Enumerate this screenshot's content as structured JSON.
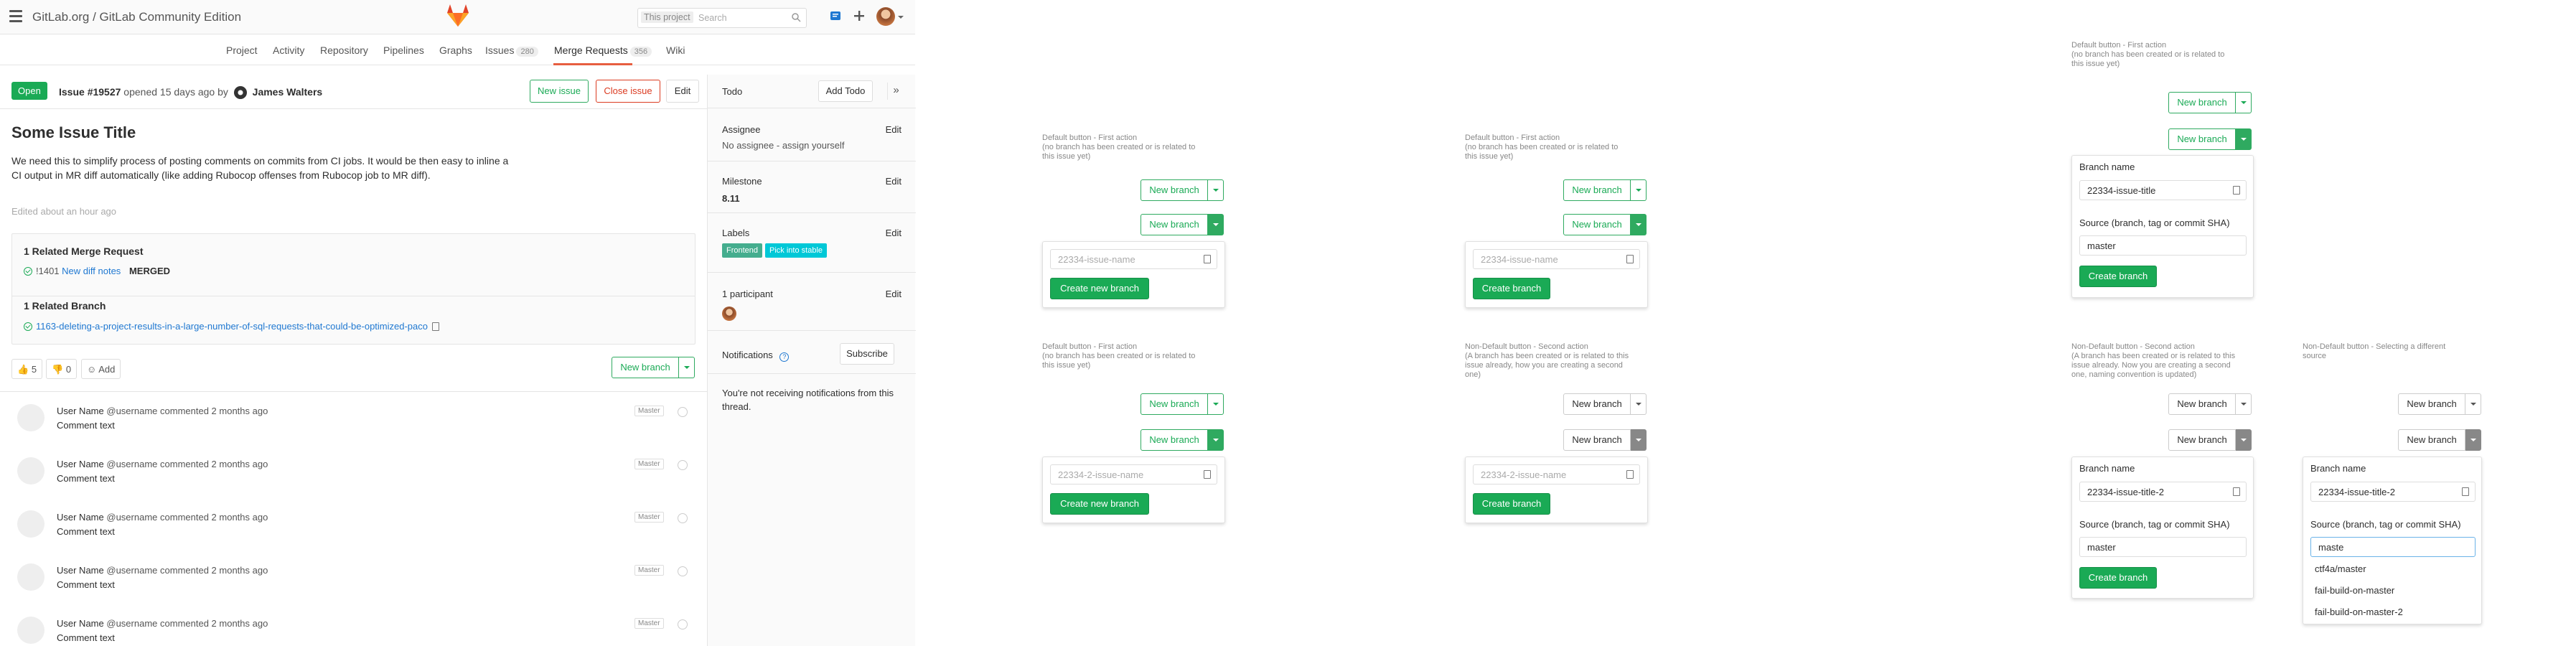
{
  "header": {
    "breadcrumb": "GitLab.org / GitLab Community Edition",
    "search_scope": "This project",
    "search_placeholder": "Search"
  },
  "nav": {
    "items": [
      {
        "label": "Project"
      },
      {
        "label": "Activity"
      },
      {
        "label": "Repository"
      },
      {
        "label": "Pipelines"
      },
      {
        "label": "Graphs"
      },
      {
        "label": "Issues",
        "count": "280"
      },
      {
        "label": "Merge Requests",
        "count": "356"
      },
      {
        "label": "Wiki"
      }
    ]
  },
  "issue": {
    "status": "Open",
    "number": "Issue #19527",
    "opened": "opened 15 days ago by",
    "author": "James Walters",
    "new_issue": "New issue",
    "close_issue": "Close issue",
    "edit": "Edit",
    "title": "Some Issue Title",
    "description": "We need this to simplify process of posting comments on commits from CI jobs. It would be then easy to inline a CI output in MR diff automatically (like adding Rubocop offenses from Rubocop job to MR diff).",
    "edited": "Edited about an hour ago"
  },
  "related": {
    "mr_heading": "1 Related Merge Request",
    "mr_ref": "!1401",
    "mr_title": "New diff notes",
    "mr_status": "MERGED",
    "branch_heading": "1 Related Branch",
    "branch_name": "1163-deleting-a-project-results-in-a-large-number-of-sql-requests-that-could-be-optimized-paco"
  },
  "awards": {
    "thumbs_up": "5",
    "thumbs_down": "0",
    "add": "Add"
  },
  "new_branch_label": "New branch",
  "comments": [
    {
      "name": "User Name",
      "handle": "@username",
      "action": "commented 2 months ago",
      "text": "Comment text",
      "tag": "Master"
    },
    {
      "name": "User Name",
      "handle": "@username",
      "action": "commented 2 months ago",
      "text": "Comment text",
      "tag": "Master"
    },
    {
      "name": "User Name",
      "handle": "@username",
      "action": "commented 2 months ago",
      "text": "Comment text",
      "tag": "Master"
    },
    {
      "name": "User Name",
      "handle": "@username",
      "action": "commented 2 months ago",
      "text": "Comment text",
      "tag": "Master"
    },
    {
      "name": "User Name",
      "handle": "@username",
      "action": "commented 2 months ago",
      "text": "Comment text",
      "tag": "Master"
    }
  ],
  "sidebar": {
    "todo": "Todo",
    "add_todo": "Add Todo",
    "assignee": "Assignee",
    "assignee_value": "No assignee - assign yourself",
    "milestone": "Milestone",
    "milestone_value": "8.11",
    "labels": "Labels",
    "label_frontend": "Frontend",
    "label_pick": "Pick into stable",
    "participants": "1 participant",
    "notifications": "Notifications",
    "subscribe": "Subscribe",
    "notify_text": "You're not receiving notifications from this thread.",
    "edit": "Edit",
    "colors": {
      "frontend": "#44ad8e",
      "pick": "#00c8d7"
    }
  },
  "mockups": {
    "cap_default_first_1": "Default button - First action\n(no branch has been created or is related to\nthis issue yet)",
    "cap_default_first_2": "Default button - First action\n(no branch has been created or is related to\nthis issue yet)",
    "cap_default_first_3": "Default button - First action\n(no branch has been created or is related to\nthis issue yet)",
    "cap_default_first_4": "Default button - First action\n(no branch has been created or is related to\nthis issue yet)",
    "cap_nondefault_1": "Non-Default button - Second action\n(A branch has been created or is related to this\nissue already, how you are creating a second\none)",
    "cap_nondefault_2": "Non-Default button - Second action\n(A branch has been created or is related to this\nissue already. Now you are creating a second\none, naming convention is updated)",
    "cap_nondefault_3": "Non-Default button - Selecting a different\nsource",
    "ph_issue_name": "22334-issue-name",
    "ph_issue_name_2": "22334-2-issue-name",
    "create_new_branch": "Create new branch",
    "create_branch": "Create branch",
    "branch_name_label": "Branch name",
    "source_label": "Source (branch, tag or commit SHA)",
    "branch_title": "22334-issue-title",
    "branch_title_2": "22334-issue-title-2",
    "source_master": "master",
    "source_typed": "maste",
    "options": [
      "ctf4a/master",
      "fail-build-on-master",
      "fail-build-on-master-2"
    ]
  }
}
